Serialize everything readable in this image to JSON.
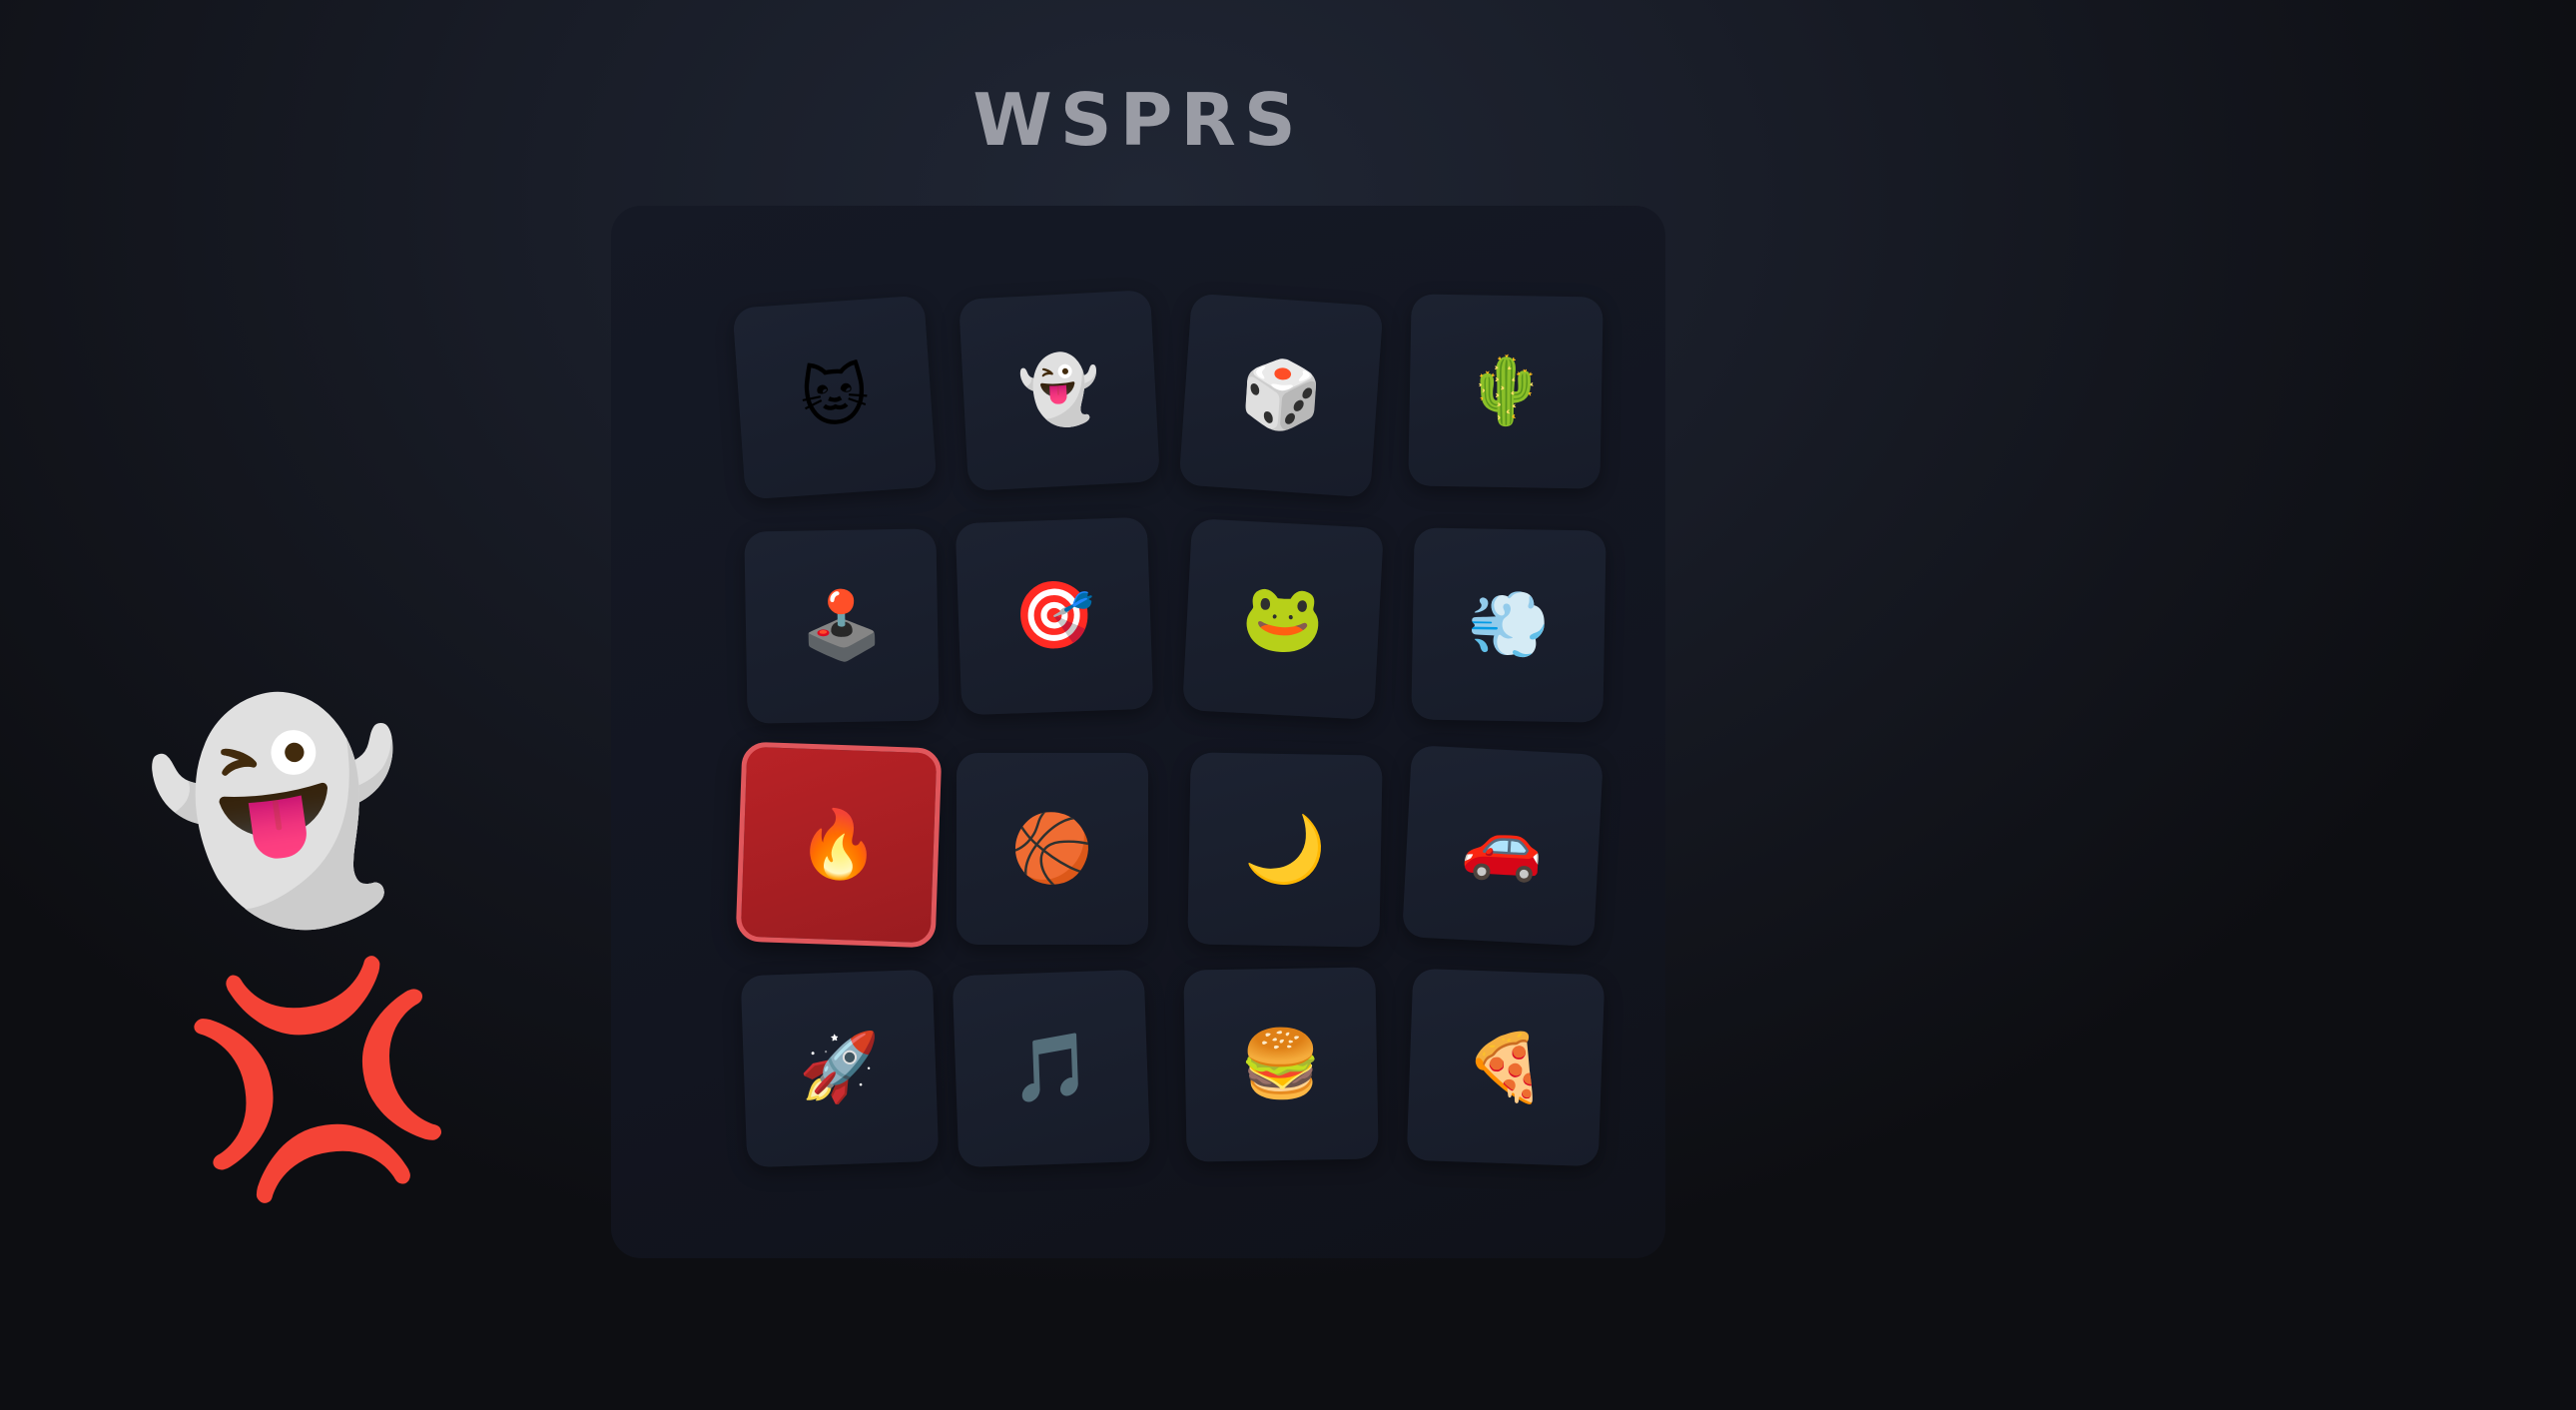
{
  "title": "WSPRS",
  "mascot": {
    "emoji": "👻💢",
    "icon": "angry-ghost-icon"
  },
  "grid": {
    "selected_index": 8,
    "selected_color": "#b92226",
    "tiles": [
      {
        "emoji": "🐱",
        "icon": "cat-face-icon"
      },
      {
        "emoji": "👻",
        "icon": "ghost-icon"
      },
      {
        "emoji": "🎲",
        "icon": "game-die-icon"
      },
      {
        "emoji": "🌵",
        "icon": "cactus-icon"
      },
      {
        "emoji": "🕹️",
        "icon": "joystick-icon"
      },
      {
        "emoji": "🎯",
        "icon": "direct-hit-icon"
      },
      {
        "emoji": "🐸",
        "icon": "frog-icon"
      },
      {
        "emoji": "💨",
        "icon": "dash-cloud-icon"
      },
      {
        "emoji": "🔥",
        "icon": "fire-icon"
      },
      {
        "emoji": "🏀",
        "icon": "basketball-icon"
      },
      {
        "emoji": "🌙",
        "icon": "crescent-moon-icon"
      },
      {
        "emoji": "🚗",
        "icon": "car-icon"
      },
      {
        "emoji": "🚀",
        "icon": "rocket-icon"
      },
      {
        "emoji": "🎵",
        "icon": "music-note-icon"
      },
      {
        "emoji": "🍔",
        "icon": "hamburger-icon"
      },
      {
        "emoji": "🍕",
        "icon": "pizza-icon"
      }
    ]
  }
}
